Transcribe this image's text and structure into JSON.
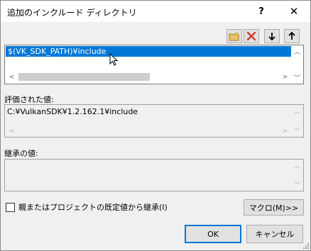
{
  "window": {
    "title": "追加のインクルード ディレクトリ",
    "help_glyph": "?",
    "close_glyph": "✕"
  },
  "toolbar": {
    "icons": [
      "new-folder-icon",
      "delete-icon",
      "move-down-icon",
      "move-up-icon"
    ],
    "delete_color": "#d03c2c"
  },
  "directory_list": {
    "items": [
      "$(VK_SDK_PATH)¥include"
    ],
    "selected_index": 0,
    "selection_color": "#0078d7"
  },
  "evaluated": {
    "label": "評価された値:",
    "value": "C:¥VulkanSDK¥1.2.162.1¥include"
  },
  "inherited": {
    "label": "継承の値:",
    "value": ""
  },
  "inherit_checkbox": {
    "label": "親またはプロジェクトの既定値から継承(I)",
    "checked": false
  },
  "buttons": {
    "macros": "マクロ(M)>>",
    "ok": "OK",
    "cancel": "キャンセル"
  },
  "accent_color": "#0078d7"
}
